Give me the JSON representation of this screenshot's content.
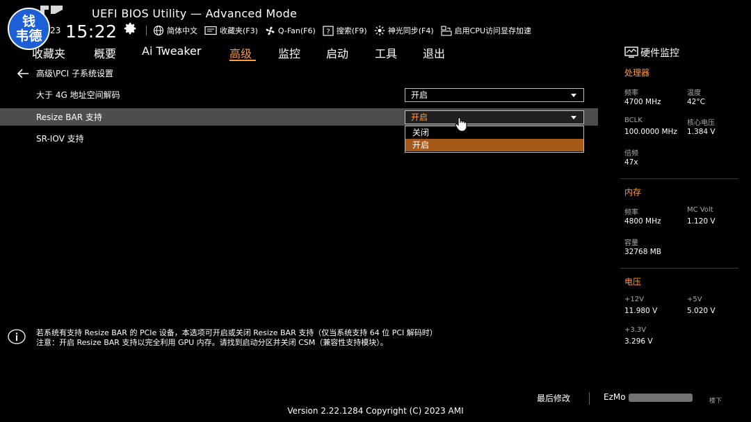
{
  "watermark": {
    "line1": "钱",
    "line2": "韦德"
  },
  "header": {
    "title": "UEFI BIOS Utility — Advanced Mode",
    "date_fragment": "23",
    "time": "15:22"
  },
  "toolbar": [
    {
      "label": "简体中文",
      "icon": "globe-icon"
    },
    {
      "label": "收藏夹(F3)",
      "icon": "favorites-icon"
    },
    {
      "label": "Q-Fan(F6)",
      "icon": "fan-icon"
    },
    {
      "label": "搜索(F9)",
      "icon": "search-help-icon"
    },
    {
      "label": "神光同步(F4)",
      "icon": "aura-icon"
    },
    {
      "label": "启用CPU访问显存加速",
      "icon": "resize-bar-icon"
    }
  ],
  "nav": {
    "tabs": [
      "收藏夹",
      "概要",
      "Ai Tweaker",
      "高级",
      "监控",
      "启动",
      "工具",
      "退出"
    ],
    "active": "高级"
  },
  "breadcrumb": "高级\\PCI 子系统设置",
  "settings": [
    {
      "label": "大于 4G 地址空间解码",
      "value": "开启"
    },
    {
      "label": "Resize BAR 支持",
      "value": "开启"
    },
    {
      "label": "SR-IOV 支持"
    }
  ],
  "dropdown": {
    "options": [
      "关闭",
      "开启"
    ],
    "selected": "开启"
  },
  "help": {
    "line1": "若系统有支持 Resize BAR 的 PCIe 设备，本选项可开启或关闭 Resize BAR 支持（仅当系统支持 64 位 PCI 解码时）",
    "line2": "注意：开启 Resize BAR 支持以完全利用 GPU 内存。请找到启动分区并关闭 CSM（兼容性支持模块）。"
  },
  "hw_monitor": {
    "title": "硬件监控",
    "cpu": {
      "title": "处理器",
      "freq_label": "频率",
      "freq": "4700 MHz",
      "temp_label": "温度",
      "temp": "42°C",
      "bclk_label": "BCLK",
      "bclk": "100.0000 MHz",
      "vcore_label": "核心电压",
      "vcore": "1.384 V",
      "ratio_label": "倍频",
      "ratio": "47x"
    },
    "memory": {
      "title": "内存",
      "freq_label": "频率",
      "freq": "4800 MHz",
      "volt_label": "MC Volt",
      "volt": "1.120 V",
      "cap_label": "容量",
      "cap": "32768 MB"
    },
    "voltage": {
      "title": "电压",
      "v12_label": "+12V",
      "v12": "11.980 V",
      "v5_label": "+5V",
      "v5": "5.020 V",
      "v33_label": "+3.3V",
      "v33": "3.296 V"
    }
  },
  "footer": {
    "last_modified": "最后修改",
    "ezmode": "EzMo",
    "extra": "楼下",
    "version": "Version 2.22.1284 Copyright (C) 2023 AMI"
  },
  "colors": {
    "accent": "#ff9a3d",
    "highlight_row": "#4d4d4d",
    "selected_option": "#a65a1a",
    "watermark_bg": "#1c5fd6"
  }
}
